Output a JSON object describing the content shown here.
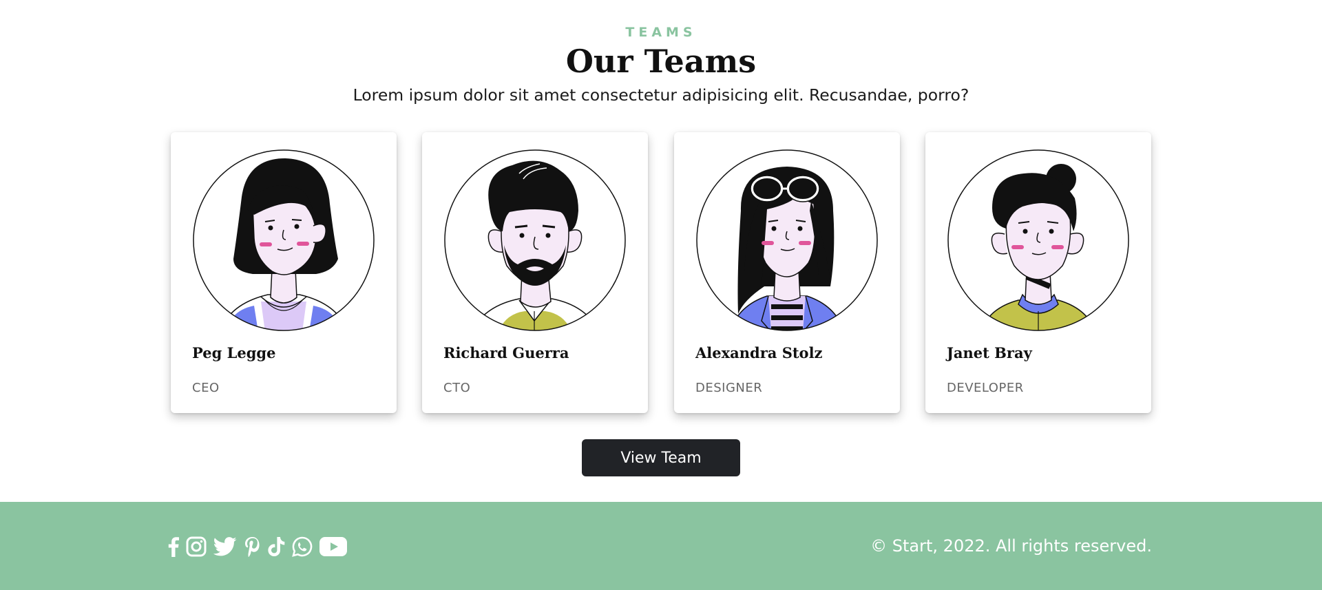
{
  "section": {
    "eyebrow": "TEAMS",
    "title": "Our Teams",
    "subtitle": "Lorem ipsum dolor sit amet consectetur adipisicing elit. Recusandae, porro?"
  },
  "team": [
    {
      "name": "Peg Legge",
      "role": "CEO",
      "avatar": "woman-bob-hair-avatar"
    },
    {
      "name": "Richard Guerra",
      "role": "CTO",
      "avatar": "man-beard-avatar"
    },
    {
      "name": "Alexandra Stolz",
      "role": "DESIGNER",
      "avatar": "woman-glasses-avatar"
    },
    {
      "name": "Janet Bray",
      "role": "DEVELOPER",
      "avatar": "woman-bun-avatar"
    }
  ],
  "cta": {
    "label": "View Team"
  },
  "footer": {
    "social_icons": [
      "facebook-icon",
      "instagram-icon",
      "twitter-icon",
      "pinterest-icon",
      "tiktok-icon",
      "whatsapp-icon",
      "youtube-icon"
    ],
    "copyright": "© Start, 2022. All rights reserved."
  },
  "colors": {
    "accent_green": "#8ac4a0",
    "button_dark": "#212327",
    "skin": "#f6e9f7",
    "blush": "#e0559a",
    "shirt_blue": "#6f7ff0",
    "shirt_olive": "#c2c24a",
    "shirt_lavender": "#dcc9f7"
  }
}
